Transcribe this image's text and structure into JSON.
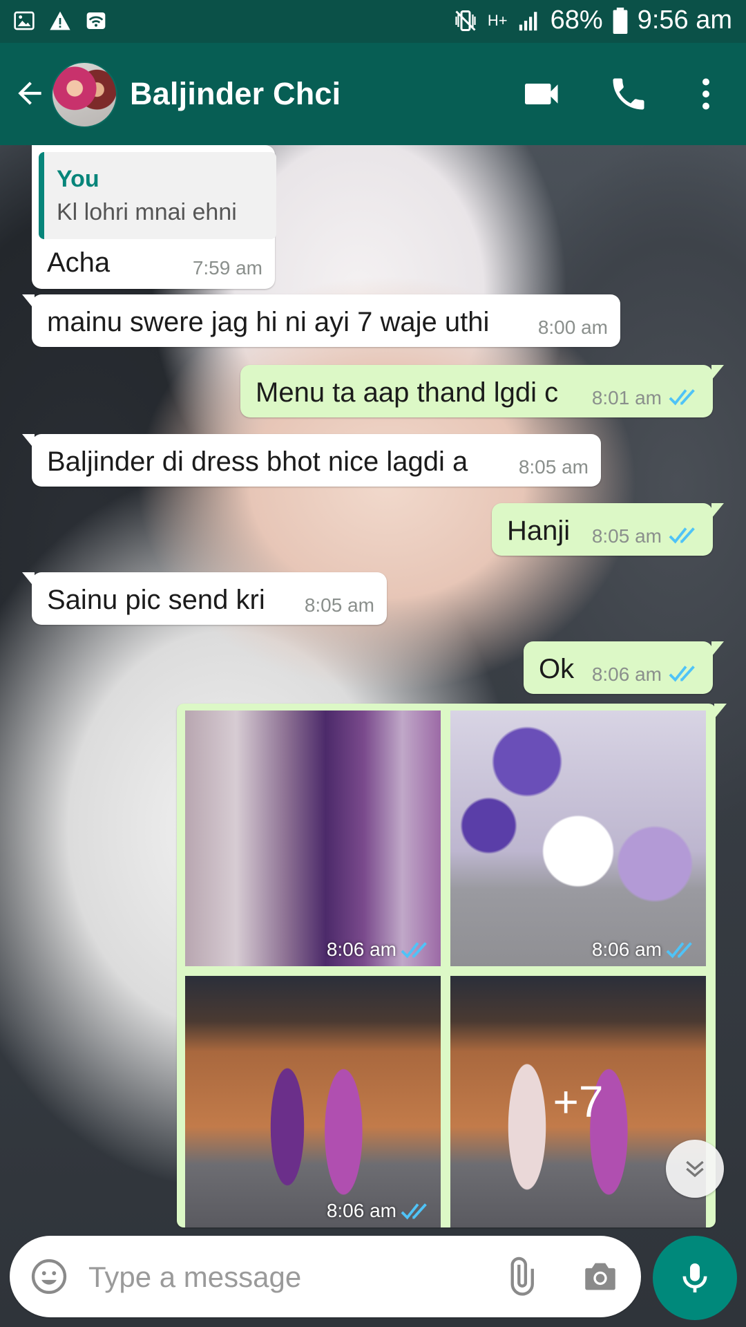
{
  "status_bar": {
    "battery": "68%",
    "network": "H+",
    "time": "9:56 am"
  },
  "header": {
    "contact_name": "Baljinder Chci"
  },
  "messages": [
    {
      "dir": "in",
      "quote_name": "You",
      "quote_text": "Kl lohri mnai ehni",
      "text": "Acha",
      "time": "7:59 am"
    },
    {
      "dir": "in",
      "text": "mainu swere jag hi ni ayi 7 waje uthi",
      "time": "8:00 am"
    },
    {
      "dir": "out",
      "text": "Menu ta aap thand lgdi c",
      "time": "8:01 am"
    },
    {
      "dir": "in",
      "text": "Baljinder di dress bhot nice lagdi a",
      "time": "8:05 am"
    },
    {
      "dir": "out",
      "text": "Hanji",
      "time": "8:05 am"
    },
    {
      "dir": "in",
      "text": "Sainu pic send kri",
      "time": "8:05 am"
    },
    {
      "dir": "out",
      "text": "Ok",
      "time": "8:06 am"
    }
  ],
  "media": {
    "photos": [
      {
        "time": "8:06 am"
      },
      {
        "time": "8:06 am"
      },
      {
        "time": "8:06 am"
      },
      {
        "more_count": "+7"
      }
    ]
  },
  "composer": {
    "placeholder": "Type a message"
  },
  "colors": {
    "header": "#075e54",
    "status_bar": "#0b5148",
    "outgoing": "#dcf8c6",
    "incoming": "#ffffff",
    "ticks": "#4fc3f7",
    "mic": "#00897b"
  }
}
